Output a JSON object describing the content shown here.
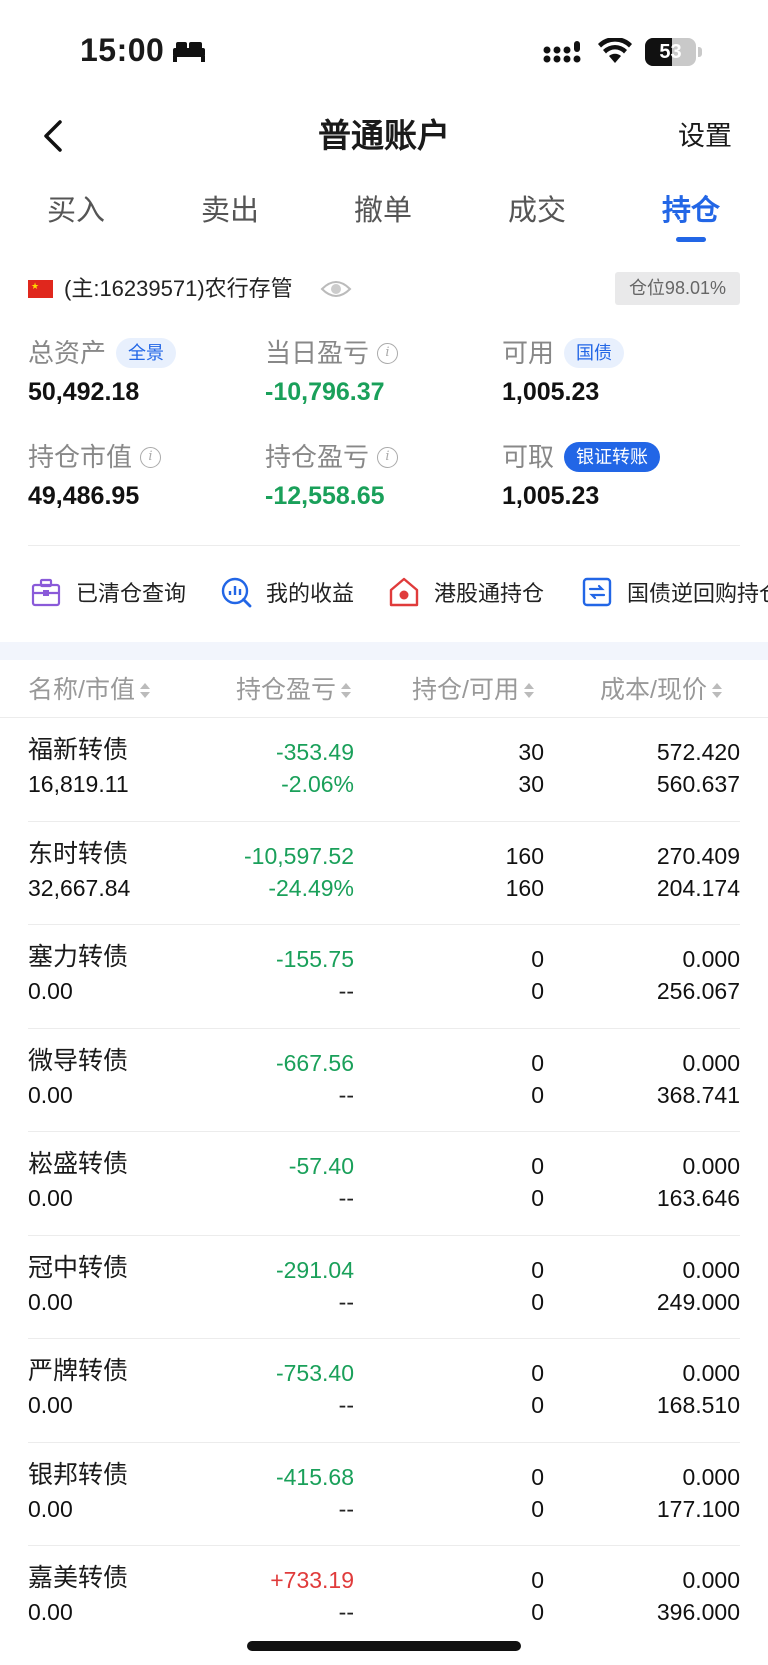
{
  "status_bar": {
    "time": "15:00",
    "battery_level": "53"
  },
  "nav": {
    "title": "普通账户",
    "settings": "设置"
  },
  "tabs": [
    {
      "label": "买入",
      "active": false
    },
    {
      "label": "卖出",
      "active": false
    },
    {
      "label": "撤单",
      "active": false
    },
    {
      "label": "成交",
      "active": false
    },
    {
      "label": "持仓",
      "active": true
    }
  ],
  "account": {
    "text": "(主:16239571)农行存管",
    "position_ratio": "仓位98.01%"
  },
  "summary": {
    "total_assets": {
      "label": "总资产",
      "tag": "全景",
      "value": "50,492.18"
    },
    "daily_pl": {
      "label": "当日盈亏",
      "value": "-10,796.37"
    },
    "available": {
      "label": "可用",
      "tag": "国债",
      "value": "1,005.23"
    },
    "market_value": {
      "label": "持仓市值",
      "value": "49,486.95"
    },
    "position_pl": {
      "label": "持仓盈亏",
      "value": "-12,558.65"
    },
    "withdrawable": {
      "label": "可取",
      "tag": "银证转账",
      "value": "1,005.23"
    }
  },
  "shortcuts": [
    {
      "label": "已清仓查询",
      "icon": "briefcase-icon"
    },
    {
      "label": "我的收益",
      "icon": "chart-search-icon"
    },
    {
      "label": "港股通持仓",
      "icon": "hk-house-icon"
    },
    {
      "label": "国债逆回购持仓",
      "icon": "repo-icon"
    }
  ],
  "table": {
    "headers": [
      "名称/市值",
      "持仓盈亏",
      "持仓/可用",
      "成本/现价"
    ],
    "rows": [
      {
        "name": "福新转债",
        "market_value": "16,819.11",
        "pl": "-353.49",
        "pl_pct": "-2.06%",
        "position": "30",
        "available": "30",
        "cost": "572.420",
        "price": "560.637",
        "tone": "green"
      },
      {
        "name": "东时转债",
        "market_value": "32,667.84",
        "pl": "-10,597.52",
        "pl_pct": "-24.49%",
        "position": "160",
        "available": "160",
        "cost": "270.409",
        "price": "204.174",
        "tone": "green"
      },
      {
        "name": "塞力转债",
        "market_value": "0.00",
        "pl": "-155.75",
        "pl_pct": "--",
        "position": "0",
        "available": "0",
        "cost": "0.000",
        "price": "256.067",
        "tone": "green"
      },
      {
        "name": "微导转债",
        "market_value": "0.00",
        "pl": "-667.56",
        "pl_pct": "--",
        "position": "0",
        "available": "0",
        "cost": "0.000",
        "price": "368.741",
        "tone": "green"
      },
      {
        "name": "崧盛转债",
        "market_value": "0.00",
        "pl": "-57.40",
        "pl_pct": "--",
        "position": "0",
        "available": "0",
        "cost": "0.000",
        "price": "163.646",
        "tone": "green"
      },
      {
        "name": "冠中转债",
        "market_value": "0.00",
        "pl": "-291.04",
        "pl_pct": "--",
        "position": "0",
        "available": "0",
        "cost": "0.000",
        "price": "249.000",
        "tone": "green"
      },
      {
        "name": "严牌转债",
        "market_value": "0.00",
        "pl": "-753.40",
        "pl_pct": "--",
        "position": "0",
        "available": "0",
        "cost": "0.000",
        "price": "168.510",
        "tone": "green"
      },
      {
        "name": "银邦转债",
        "market_value": "0.00",
        "pl": "-415.68",
        "pl_pct": "--",
        "position": "0",
        "available": "0",
        "cost": "0.000",
        "price": "177.100",
        "tone": "green"
      },
      {
        "name": "嘉美转债",
        "market_value": "0.00",
        "pl": "+733.19",
        "pl_pct": "--",
        "position": "0",
        "available": "0",
        "cost": "0.000",
        "price": "396.000",
        "tone": "red"
      }
    ]
  },
  "colors": {
    "accent": "#2266e6",
    "loss": "#1aa05a",
    "gain": "#e03b3b"
  }
}
